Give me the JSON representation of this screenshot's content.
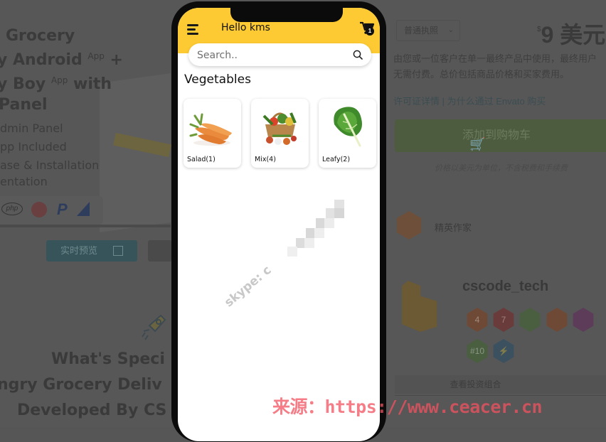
{
  "background_page": {
    "hero": {
      "title_lines": [
        "Grocery",
        "y Android",
        "y Boy",
        "Panel"
      ],
      "title_sup": [
        "App",
        "App"
      ],
      "title_suffixes": [
        "+",
        "with"
      ],
      "features": [
        "dmin Panel",
        "pp Included",
        "ase & Installation",
        "entation"
      ],
      "tech_icons": [
        "php-icon",
        "api-icon",
        "paypal-icon",
        "analytics-icon"
      ]
    },
    "preview_button": {
      "label": "实时预览"
    },
    "special_heading": [
      "What's Speci",
      "ngry Grocery Deliv",
      "Developed By CS"
    ],
    "license_select": {
      "value": "普通执照"
    },
    "price": {
      "currency_sign": "$",
      "amount": "9",
      "unit": "美元"
    },
    "license_desc": [
      "由您或一位客户在单一最终产品中使用，最终用户",
      "无需付费。总价包括商品价格和买家费用。"
    ],
    "license_links": "许可证详情 | 为什么通过 Envato 购买",
    "add_to_cart": {
      "label": "添加到购物车"
    },
    "price_note": "价格以美元为单位，不含税费和手续费",
    "elite_author": {
      "label": "精英作家"
    },
    "author": {
      "name": "cscode_tech",
      "badges": [
        {
          "text": "4",
          "color": "#6e4a36"
        },
        {
          "text": "7",
          "color": "#6a3b3b"
        },
        {
          "text": "",
          "color": "#4a5e40"
        },
        {
          "text": "",
          "color": "#6e4a36"
        },
        {
          "text": "",
          "color": "#5d3c5a"
        },
        {
          "text": "#10",
          "color": "#4a5e40"
        },
        {
          "text": "⚡",
          "color": "#3c5160"
        }
      ]
    },
    "view_portfolio": "查看投资组合"
  },
  "app": {
    "header": {
      "title": "Hello kms",
      "cart_count": "1"
    },
    "search": {
      "placeholder": "Search..",
      "value": ""
    },
    "section_title": "Vegetables",
    "categories": [
      {
        "label": "Salad(1)",
        "image": "carrots-image"
      },
      {
        "label": "Mix(4)",
        "image": "vegetable-basket-image"
      },
      {
        "label": "Leafy(2)",
        "image": "leafy-greens-image"
      }
    ],
    "contact_watermark": "skype: c"
  },
  "colors": {
    "app_bar": "#fdca33",
    "watermark": "#f2525f"
  },
  "source_watermark": "来源：https://www.ceacer.cn"
}
